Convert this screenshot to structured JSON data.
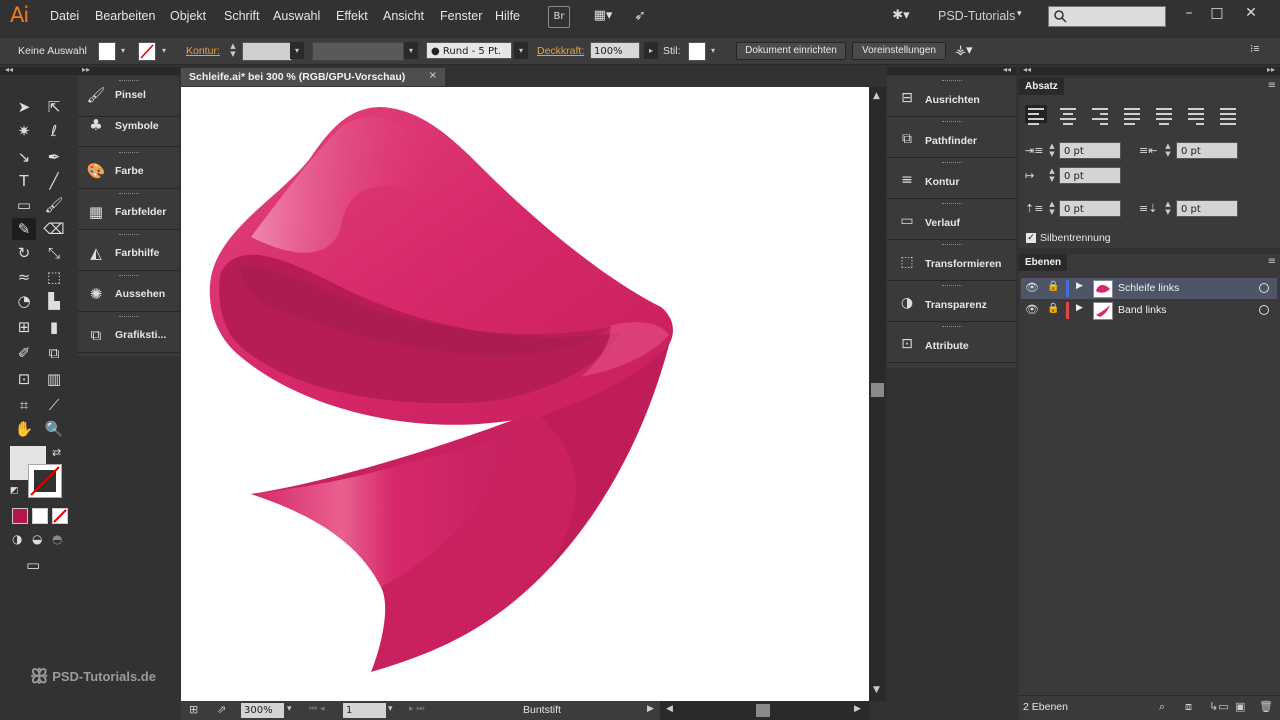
{
  "menubar": {
    "logo": "Ai",
    "items": [
      "Datei",
      "Bearbeiten",
      "Objekt",
      "Schrift",
      "Auswahl",
      "Effekt",
      "Ansicht",
      "Fenster",
      "Hilfe"
    ],
    "bridge_label": "Br",
    "workspace": "PSD-Tutorials",
    "search_placeholder": ""
  },
  "controlbar": {
    "selection": "Keine Auswahl",
    "stroke_label": "Kontur:",
    "brush": "Rund - 5 Pt.",
    "opacity_label": "Deckkraft:",
    "opacity_value": "100%",
    "style_label": "Stil:",
    "document_setup": "Dokument einrichten",
    "preferences": "Voreinstellungen"
  },
  "collapsed_panels": [
    "Pinsel",
    "Symbole",
    "Farbe",
    "Farbfelder",
    "Farbhilfe",
    "Aussehen",
    "Grafiksti..."
  ],
  "document": {
    "tab_title": "Schleife.ai* bei 300 % (RGB/GPU-Vorschau)",
    "close_glyph": "×",
    "zoom": "300%",
    "artboard": "1",
    "tool_status": "Buntstift"
  },
  "mid_panels": [
    "Ausrichten",
    "Pathfinder",
    "Kontur",
    "Verlauf",
    "Transformieren",
    "Transparenz",
    "Attribute"
  ],
  "absatz": {
    "title": "Absatz",
    "left_indent": "0 pt",
    "right_indent": "0 pt",
    "first_line_indent": "0 pt",
    "space_before": "0 pt",
    "space_after": "0 pt",
    "hyphenation_label": "Silbentrennung"
  },
  "ebenen": {
    "title": "Ebenen",
    "layers": [
      {
        "name": "Schleife links",
        "color": "#4a6fd0",
        "selected": true
      },
      {
        "name": "Band links",
        "color": "#e04848",
        "selected": false
      }
    ],
    "count": "2 Ebenen"
  },
  "colors": {
    "accent": "#f07b1d",
    "ribbon": "#d6286a",
    "ribbon_dark": "#a81c50",
    "ribbon_light": "#f07aa8",
    "canvas_bg": "#ffffff",
    "ui_bg": "#323232"
  },
  "watermark": "PSD-Tutorials.de"
}
